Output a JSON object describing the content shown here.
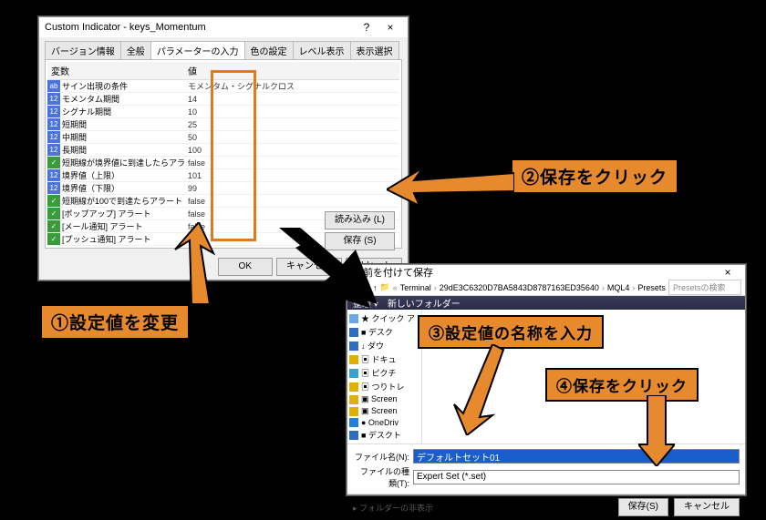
{
  "dlg1": {
    "title": "Custom Indicator - keys_Momentum",
    "help": "?",
    "close": "×",
    "tabs": [
      "バージョン情報",
      "全般",
      "パラメーターの入力",
      "色の設定",
      "レベル表示",
      "表示選択"
    ],
    "col_name": "変数",
    "col_value": "値",
    "rows": [
      {
        "t": "ab",
        "n": "サイン出現の条件",
        "v": "モメンタム・シグナルクロス"
      },
      {
        "t": "12",
        "n": "モメンタム期間",
        "v": "14"
      },
      {
        "t": "12",
        "n": "シグナル期間",
        "v": "10"
      },
      {
        "t": "12",
        "n": "短期間",
        "v": "25"
      },
      {
        "t": "12",
        "n": "中期間",
        "v": "50"
      },
      {
        "t": "12",
        "n": "長期間",
        "v": "100"
      },
      {
        "t": "tf",
        "n": "短期線が境界値に到達したらアラート",
        "v": "false"
      },
      {
        "t": "12",
        "n": "境界値（上限）",
        "v": "101"
      },
      {
        "t": "12",
        "n": "境界値（下限）",
        "v": "99"
      },
      {
        "t": "tf",
        "n": "短期線が100で到達たらアラート",
        "v": "false"
      },
      {
        "t": "tf",
        "n": "[ポップアップ] アラート",
        "v": "false"
      },
      {
        "t": "tf",
        "n": "[メール通知] アラート",
        "v": "false"
      },
      {
        "t": "tf",
        "n": "[プッシュ通知] アラート",
        "v": "false"
      }
    ],
    "load": "読み込み (L)",
    "save": "保存 (S)",
    "ok": "OK",
    "cancel": "キャンセル",
    "reset": "リセット"
  },
  "dlg2": {
    "title": "名前を付けて保存",
    "crumbs": [
      "Terminal",
      "29dE3C6320D7BA5843D8787163ED35640",
      "MQL4",
      "Presets"
    ],
    "search_ph": "Presetsの検索",
    "toolbar": {
      "org": "整理 ▾",
      "new": "新しいフォルダー"
    },
    "tree": [
      {
        "c": "#6aa7e8",
        "n": "★ クイック ア"
      },
      {
        "c": "#2e6cc0",
        "n": "■ デスク"
      },
      {
        "c": "#2e6cc0",
        "n": "↓ ダウ"
      },
      {
        "c": "#e0b000",
        "n": "▣ ドキュ"
      },
      {
        "c": "#3aa0d0",
        "n": "▣ ピクチ"
      },
      {
        "c": "#e0b000",
        "n": "▣ つりトレ"
      },
      {
        "c": "#e0b000",
        "n": "▣ Screen"
      },
      {
        "c": "#e0b000",
        "n": "▣ Screen"
      },
      {
        "c": "#2280d8",
        "n": "● OneDriv"
      },
      {
        "c": "#2e6cc0",
        "n": "■ デスクト"
      }
    ],
    "filename_label": "ファイル名(N):",
    "filename_value": "デフォルトセット01",
    "filetype_label": "ファイルの種類(T):",
    "filetype_value": "Expert Set (*.set)",
    "folders": "▸ フォルダーの非表示",
    "save": "保存(S)",
    "cancel": "キャンセル"
  },
  "callouts": {
    "c1": "①設定値を変更",
    "c2": "②保存をクリック",
    "c3": "③設定値の名称を入力",
    "c4": "④保存をクリック"
  }
}
